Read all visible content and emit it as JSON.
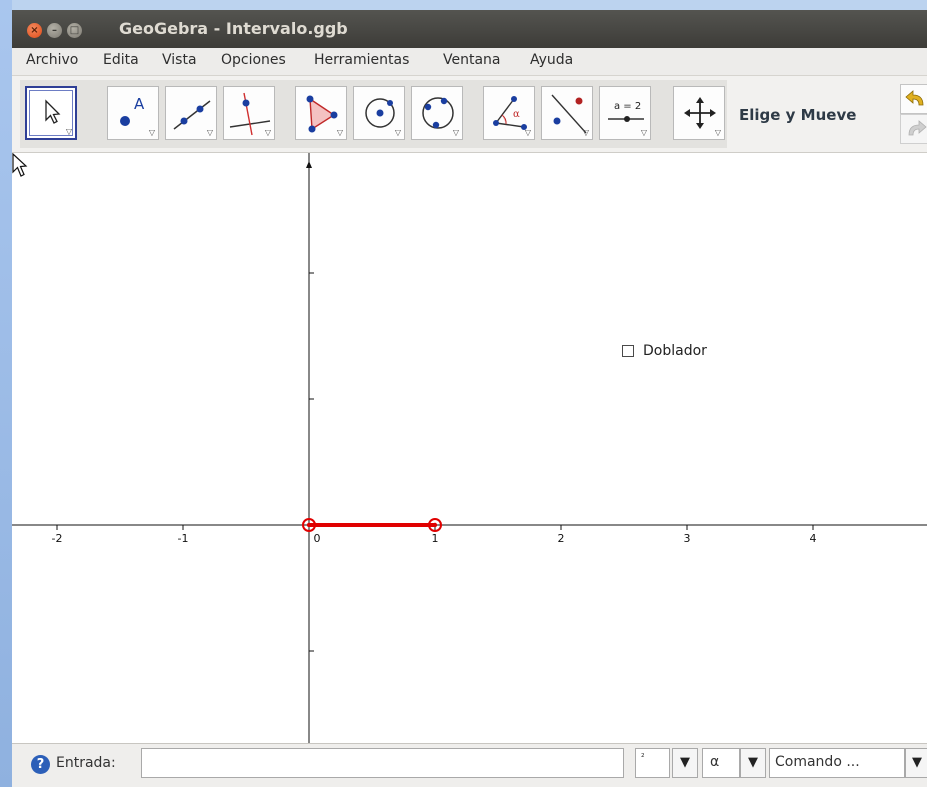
{
  "window": {
    "title": "GeoGebra - Intervalo.ggb"
  },
  "menu": [
    "Archivo",
    "Edita",
    "Vista",
    "Opciones",
    "Herramientas",
    "Ventana",
    "Ayuda"
  ],
  "toolbar": {
    "tools": [
      {
        "name": "move-tool",
        "selected": true
      },
      {
        "name": "point-tool"
      },
      {
        "name": "line-tool"
      },
      {
        "name": "perpendicular-line-tool"
      },
      {
        "name": "polygon-tool"
      },
      {
        "name": "circle-center-point-tool"
      },
      {
        "name": "circle-three-points-tool"
      },
      {
        "name": "angle-tool"
      },
      {
        "name": "reflect-tool"
      },
      {
        "name": "slider-tool",
        "label": "a = 2"
      },
      {
        "name": "move-graphics-view-tool"
      }
    ],
    "current_tool_name": "Elige y Mueve"
  },
  "graphics": {
    "x_ticks": [
      "-2",
      "-1",
      "0",
      "1",
      "2",
      "3",
      "4"
    ],
    "segment": {
      "from": 0,
      "to": 1,
      "color": "#e00000"
    },
    "checkbox_label": "Doblador"
  },
  "input_bar": {
    "label": "Entrada:",
    "value": "",
    "superscript_button": "²",
    "greek_button": "α",
    "command_placeholder": "Comando ..."
  },
  "colors": {
    "accent": "#2f3f96",
    "segment": "#e00000"
  }
}
